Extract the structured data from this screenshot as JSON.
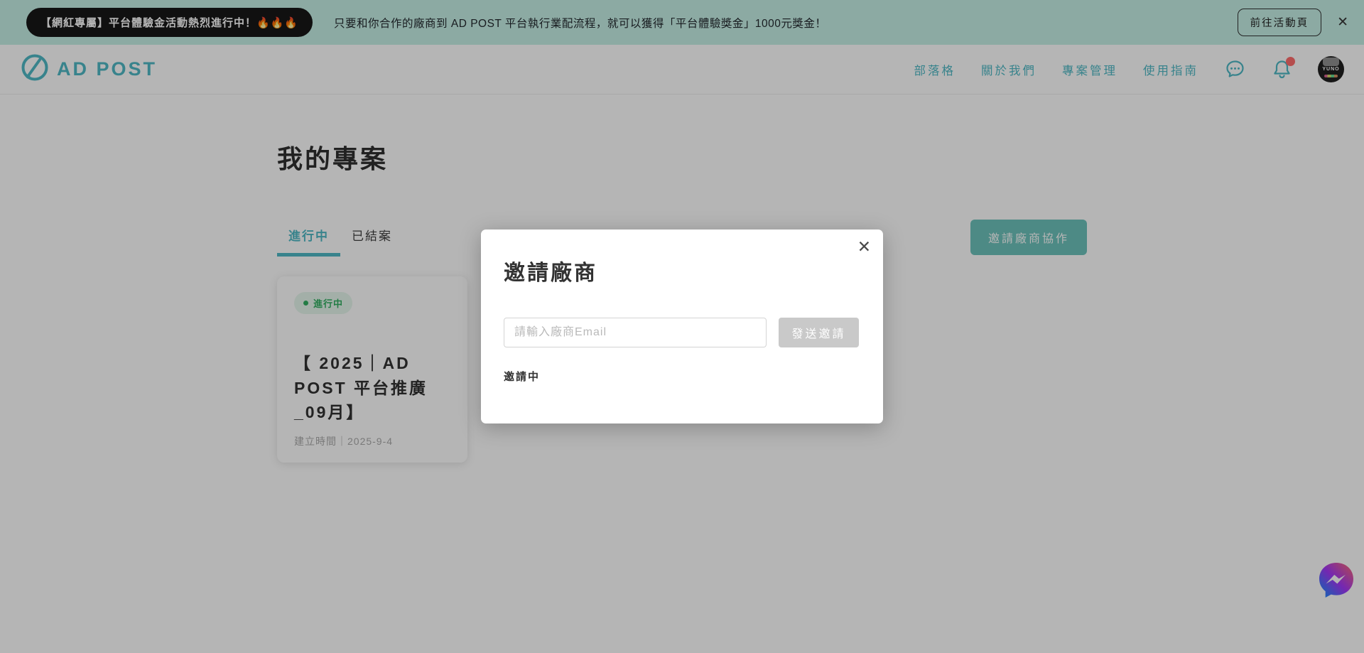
{
  "banner": {
    "badge": "【網紅專屬】平台體驗金活動熱烈進行中！🔥🔥🔥",
    "message": "只要和你合作的廠商到 AD POST 平台執行業配流程，就可以獲得「平台體驗獎金」1000元獎金！",
    "cta_label": "前往活動頁",
    "close_icon": "✕"
  },
  "header": {
    "brand": "AD POST",
    "nav": [
      {
        "label": "部落格"
      },
      {
        "label": "關於我們"
      },
      {
        "label": "專案管理"
      },
      {
        "label": "使用指南"
      }
    ],
    "icons": {
      "chat": "chat-bubble-icon",
      "bell": "bell-icon",
      "notification": "red-dot"
    },
    "avatar_label": "YUNO"
  },
  "main": {
    "title": "我的專案",
    "tabs": [
      {
        "label": "進行中",
        "active": true
      },
      {
        "label": "已結案",
        "active": false
      }
    ],
    "invite_button_label": "邀請廠商協作",
    "card": {
      "status": "進行中",
      "title": "【 2025｜AD POST 平台推廣_09月】",
      "created": "建立時間｜2025-9-4"
    }
  },
  "modal": {
    "title": "邀請廠商",
    "input_placeholder": "請輸入廠商Email",
    "submit_label": "發送邀請",
    "section_label": "邀請中",
    "close_icon": "✕"
  },
  "colors": {
    "accent": "#4db8c4",
    "banner-bg": "#c4efe6",
    "btn-teal": "#6ac2ba",
    "green": "#2fae5f",
    "badge-bg": "#e6f6ec",
    "red": "#ff6b6b"
  }
}
